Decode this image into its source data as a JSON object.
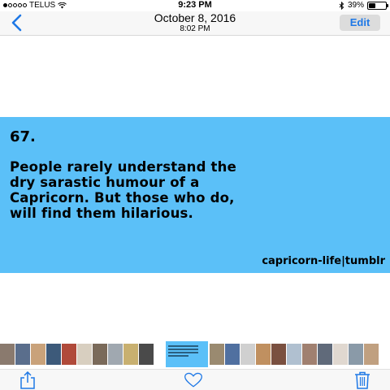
{
  "status_bar": {
    "carrier": "TELUS",
    "time": "9:23 PM",
    "battery_text": "39%",
    "battery_level": 0.39
  },
  "nav": {
    "date": "October 8, 2016",
    "time": "8:02 PM",
    "edit_label": "Edit",
    "accent": "#1e78e6"
  },
  "photo": {
    "number": "67.",
    "quote_lines": [
      "People rarely understand the",
      "dry sarastic humour of a",
      "Capricorn. But those who do,",
      "will find them hilarious."
    ],
    "source": "capricorn-life|tumblr",
    "background": "#5bc0f8"
  },
  "thumbnails": {
    "left_colors": [
      "#8a7a6e",
      "#5a6e8c",
      "#c9a27a",
      "#3d5a7a",
      "#b04a3a",
      "#d8cfc0",
      "#7a6a5a",
      "#a0a8b0",
      "#c8b070",
      "#4a4a4a",
      "#e0e0e0",
      "#6a8aa0"
    ],
    "right_colors": [
      "#9a8a70",
      "#5070a0",
      "#d0d0d0",
      "#c09060",
      "#7a5040",
      "#b0c0d0",
      "#a08070",
      "#606a7a",
      "#e0d8d0",
      "#8a9aa8",
      "#c0a080",
      "#5a6a80"
    ]
  },
  "toolbar": {
    "icons": [
      "share-icon",
      "heart-icon",
      "trash-icon"
    ]
  }
}
